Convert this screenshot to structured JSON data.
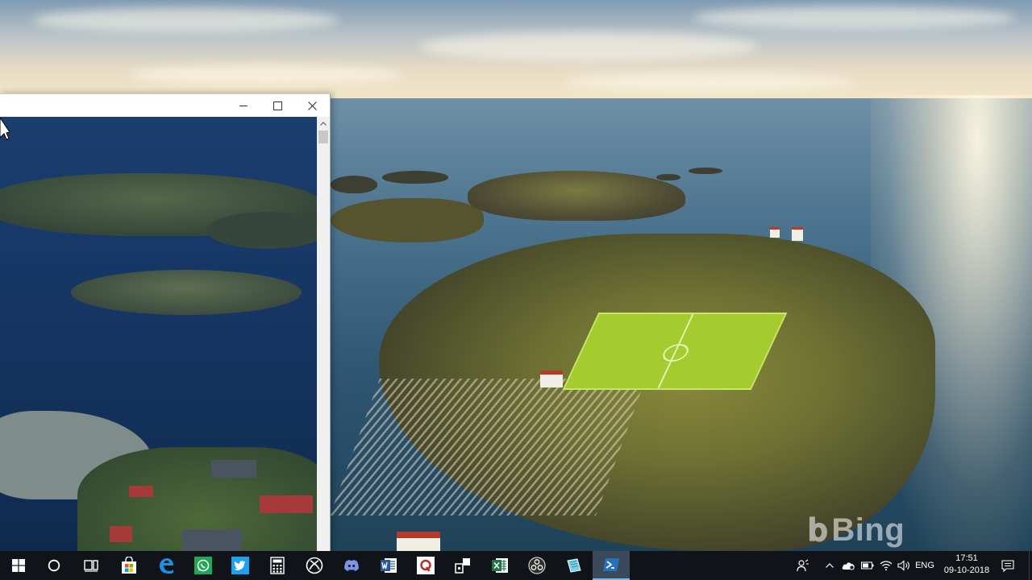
{
  "desktop": {
    "wallpaper_watermark": "Bing"
  },
  "window": {
    "buttons": {
      "minimize_icon": "minimize-icon",
      "maximize_icon": "maximize-icon",
      "close_icon": "close-icon"
    }
  },
  "taskbar": {
    "apps": [
      {
        "name": "Start",
        "icon": "windows-logo-icon"
      },
      {
        "name": "Search",
        "icon": "cortana-circle-icon"
      },
      {
        "name": "Task View",
        "icon": "task-view-icon"
      },
      {
        "name": "Microsoft Store",
        "icon": "store-bag-icon"
      },
      {
        "name": "Microsoft Edge",
        "icon": "edge-icon"
      },
      {
        "name": "WhatsApp",
        "icon": "whatsapp-icon"
      },
      {
        "name": "Twitter",
        "icon": "twitter-bird-icon"
      },
      {
        "name": "Calculator",
        "icon": "calculator-icon"
      },
      {
        "name": "Xbox",
        "icon": "xbox-icon"
      },
      {
        "name": "Discord",
        "icon": "discord-icon"
      },
      {
        "name": "Word",
        "icon": "word-icon"
      },
      {
        "name": "Quora",
        "icon": "quora-icon"
      },
      {
        "name": "Connect",
        "icon": "connect-icon"
      },
      {
        "name": "Excel",
        "icon": "excel-icon"
      },
      {
        "name": "OBS",
        "icon": "obs-icon"
      },
      {
        "name": "Notes",
        "icon": "notes-icon"
      },
      {
        "name": "PowerShell",
        "icon": "powershell-icon"
      }
    ],
    "tray": {
      "language": "ENG",
      "time": "17:51",
      "date": "09-10-2018"
    }
  },
  "colors": {
    "taskbar_bg": "#101418",
    "active_indicator": "#76b9ed",
    "accent_blue": "#0078d7"
  }
}
